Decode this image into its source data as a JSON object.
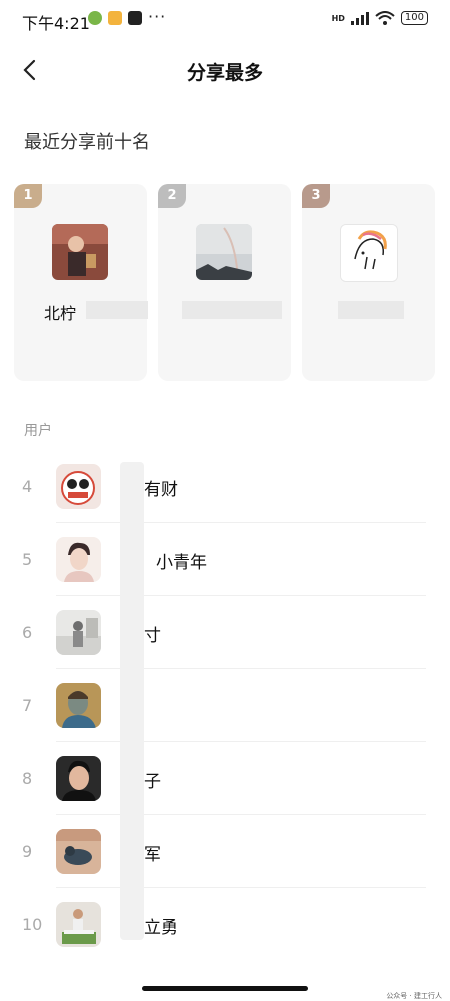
{
  "status_bar": {
    "time": "下午4:21",
    "more": "···",
    "hd": "HD",
    "battery": "100"
  },
  "header": {
    "title": "分享最多"
  },
  "top_section": {
    "title": "最近分享前十名",
    "cards": [
      {
        "rank": "1",
        "name": "北柠",
        "badge_color": "#c9ad8c"
      },
      {
        "rank": "2",
        "name": "",
        "badge_color": "#bdbdbd"
      },
      {
        "rank": "3",
        "name": "",
        "badge_color": "#b89a8c"
      }
    ]
  },
  "users_section": {
    "label": "用户",
    "items": [
      {
        "rank": "4",
        "name": "有财"
      },
      {
        "rank": "5",
        "name": "小青年"
      },
      {
        "rank": "6",
        "name": "寸"
      },
      {
        "rank": "7",
        "name": ""
      },
      {
        "rank": "8",
        "name": "子"
      },
      {
        "rank": "9",
        "name": "军"
      },
      {
        "rank": "10",
        "name": "立勇"
      }
    ]
  },
  "watermark": "公众号 · 建工行人",
  "colors": {
    "background": "#ffffff",
    "card_bg": "#f6f6f6",
    "muted": "#999999"
  }
}
